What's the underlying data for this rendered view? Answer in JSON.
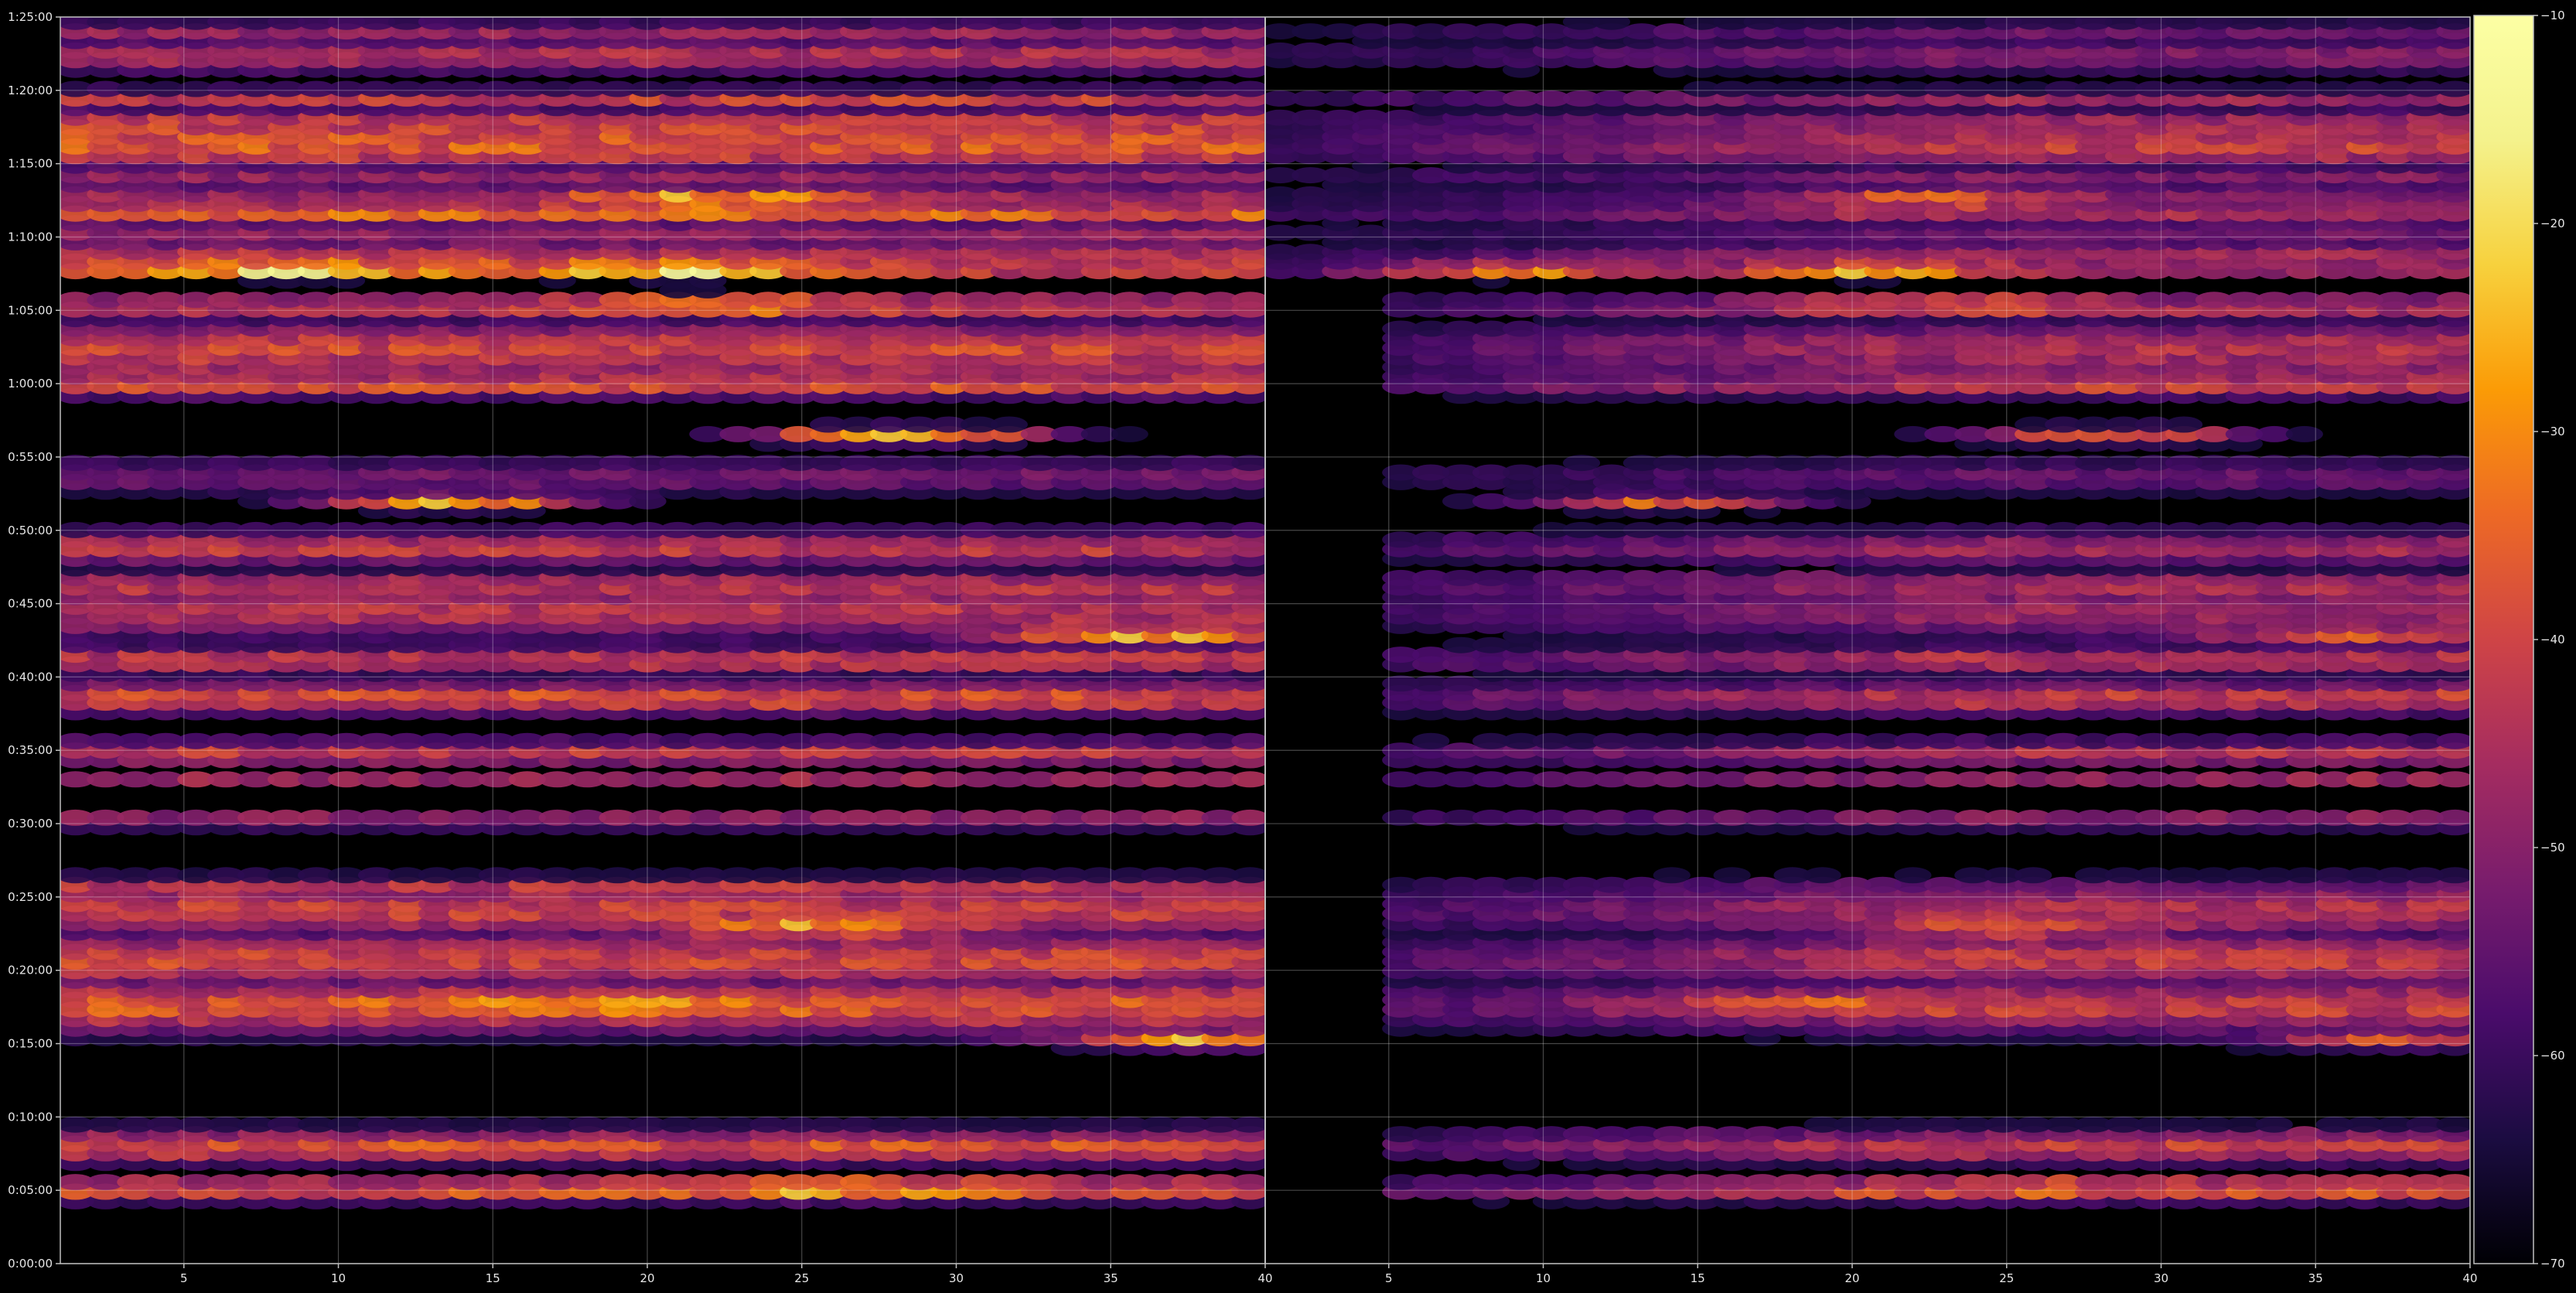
{
  "chart_data": {
    "type": "heatmap",
    "title": "",
    "xlabel": "",
    "ylabel": "",
    "panels": [
      {
        "name": "",
        "xlim": [
          1,
          40
        ],
        "xticks": [
          5,
          10,
          15,
          20,
          25,
          30,
          35,
          40
        ]
      },
      {
        "name": "",
        "xlim": [
          1,
          40
        ],
        "xticks": [
          5,
          10,
          15,
          20,
          25,
          30,
          35,
          40
        ]
      }
    ],
    "yticks": [
      "0:00:00",
      "0:05:00",
      "0:10:00",
      "0:15:00",
      "0:20:00",
      "0:25:00",
      "0:30:00",
      "0:35:00",
      "0:40:00",
      "0:45:00",
      "0:50:00",
      "0:55:00",
      "1:00:00",
      "1:05:00",
      "1:10:00",
      "1:15:00",
      "1:20:00",
      "1:25:00"
    ],
    "ylim_seconds": [
      0,
      5100
    ],
    "colorbar": {
      "colormap": "inferno",
      "range": [
        -70,
        -10
      ],
      "ticks": [
        -70,
        -60,
        -50,
        -40,
        -30,
        -20,
        -10
      ]
    },
    "grid": true,
    "rows_per_panel": 40,
    "bands": [
      {
        "t": 0.06,
        "hw": 0.008,
        "a": 0.58,
        "b": 0.58
      },
      {
        "t": 0.095,
        "hw": 0.012,
        "a": 0.56,
        "b": 0.5
      },
      {
        "t": 0.208,
        "hw": 0.02,
        "a": 0.57,
        "b": 0.5
      },
      {
        "t": 0.245,
        "hw": 0.02,
        "a": 0.52,
        "b": 0.48
      },
      {
        "t": 0.285,
        "hw": 0.02,
        "a": 0.5,
        "b": 0.45
      },
      {
        "t": 0.305,
        "hw": 0.004,
        "a": 0.5,
        "b": 0.3
      },
      {
        "t": 0.355,
        "hw": 0.004,
        "a": 0.52,
        "b": 0.5
      },
      {
        "t": 0.388,
        "hw": 0.005,
        "a": 0.4,
        "b": 0.4
      },
      {
        "t": 0.41,
        "hw": 0.009,
        "a": 0.48,
        "b": 0.45
      },
      {
        "t": 0.455,
        "hw": 0.012,
        "a": 0.55,
        "b": 0.5
      },
      {
        "t": 0.485,
        "hw": 0.01,
        "a": 0.5,
        "b": 0.48
      },
      {
        "t": 0.525,
        "hw": 0.02,
        "a": 0.45,
        "b": 0.4
      },
      {
        "t": 0.545,
        "hw": 0.01,
        "a": 0.48,
        "b": 0.44
      },
      {
        "t": 0.575,
        "hw": 0.012,
        "a": 0.48,
        "b": 0.42
      },
      {
        "t": 0.632,
        "hw": 0.012,
        "a": 0.3,
        "b": 0.28
      },
      {
        "t": 0.705,
        "hw": 0.008,
        "a": 0.55,
        "b": 0.5
      },
      {
        "t": 0.715,
        "hw": 0.008,
        "a": 0.5,
        "b": 0.45
      },
      {
        "t": 0.735,
        "hw": 0.02,
        "a": 0.52,
        "b": 0.45
      },
      {
        "t": 0.768,
        "hw": 0.008,
        "a": 0.5,
        "b": 0.45
      },
      {
        "t": 0.8,
        "hw": 0.006,
        "a": 0.42,
        "b": 0.38
      },
      {
        "t": 0.825,
        "hw": 0.01,
        "a": 0.38,
        "b": 0.3
      },
      {
        "t": 0.843,
        "hw": 0.01,
        "a": 0.45,
        "b": 0.4
      },
      {
        "t": 0.87,
        "hw": 0.005,
        "a": 0.5,
        "b": 0.45
      },
      {
        "t": 0.895,
        "hw": 0.013,
        "a": 0.58,
        "b": 0.5
      },
      {
        "t": 0.825,
        "hw": 0.004,
        "a": 0.45,
        "b": 0.3
      },
      {
        "t": 0.822,
        "hw": 0.01,
        "a": 0.25,
        "b": 0.25
      },
      {
        "t": 0.842,
        "hw": 0.004,
        "a": 0.6,
        "b": 0.45
      },
      {
        "t": 0.81,
        "hw": 0.004,
        "a": 0.5,
        "b": 0.45
      },
      {
        "t": 0.8,
        "hw": 0.006,
        "a": 0.65,
        "b": 0.5
      },
      {
        "t": 0.905,
        "hw": 0.02,
        "a": 0.55,
        "b": 0.45
      },
      {
        "t": 0.848,
        "hw": 0.004,
        "a": 0.5,
        "b": 0.4
      },
      {
        "t": 0.855,
        "hw": 0.004,
        "a": 0.55,
        "b": 0.45
      },
      {
        "t": 0.885,
        "hw": 0.004,
        "a": 0.55,
        "b": 0.45
      },
      {
        "t": 0.915,
        "hw": 0.008,
        "a": 0.58,
        "b": 0.48
      },
      {
        "t": 0.935,
        "hw": 0.006,
        "a": 0.5,
        "b": 0.4
      },
      {
        "t": 0.97,
        "hw": 0.012,
        "a": 0.45,
        "b": 0.35
      },
      {
        "t": 0.99,
        "hw": 0.006,
        "a": 0.4,
        "b": 0.3
      }
    ],
    "peaks": [
      {
        "t": 0.798,
        "x": 0.2,
        "v": 0.9
      },
      {
        "t": 0.798,
        "x": 0.5,
        "v": 0.95
      },
      {
        "t": 0.77,
        "x": 0.55,
        "v": 0.75
      },
      {
        "t": 0.855,
        "x": 0.55,
        "v": 0.8
      },
      {
        "t": 0.665,
        "x": 0.7,
        "v": 0.8
      },
      {
        "t": 0.612,
        "x": 0.33,
        "v": 0.75
      },
      {
        "t": 0.505,
        "x": 0.9,
        "v": 0.78
      },
      {
        "t": 0.27,
        "x": 0.62,
        "v": 0.78
      },
      {
        "t": 0.21,
        "x": 0.45,
        "v": 0.75
      },
      {
        "t": 0.06,
        "x": 0.65,
        "v": 0.75
      },
      {
        "t": 0.18,
        "x": 0.95,
        "v": 0.72
      }
    ]
  }
}
